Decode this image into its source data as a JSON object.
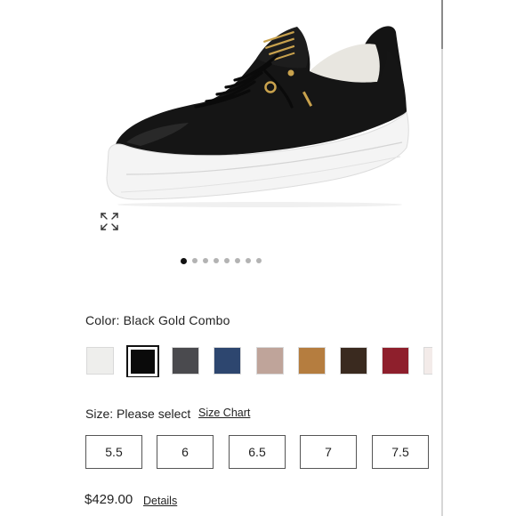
{
  "gallery": {
    "product_image_alt": "Black leather platform sneaker with gold accents",
    "dots_total": 8,
    "active_dot": 0
  },
  "color": {
    "label": "Color:",
    "selected": "Black Gold Combo",
    "swatches": [
      {
        "name": "white",
        "hex": "#eeeeec"
      },
      {
        "name": "black",
        "hex": "#0a0a0a",
        "selected": true
      },
      {
        "name": "dark-grey",
        "hex": "#4a4a4e"
      },
      {
        "name": "navy",
        "hex": "#2d466f"
      },
      {
        "name": "metallic-rose",
        "hex": "#bfa49a"
      },
      {
        "name": "cognac",
        "hex": "#b57d3f"
      },
      {
        "name": "dark-brown",
        "hex": "#3a2a1f"
      },
      {
        "name": "burgundy",
        "hex": "#8e1f2c"
      },
      {
        "name": "white-blush",
        "hex": "#f3ebe9"
      }
    ]
  },
  "size": {
    "label": "Size:",
    "placeholder": "Please select",
    "chart_link": "Size Chart",
    "options": [
      "5.5",
      "6",
      "6.5",
      "7",
      "7.5"
    ]
  },
  "price": {
    "amount": "$429.00",
    "details_link": "Details"
  }
}
